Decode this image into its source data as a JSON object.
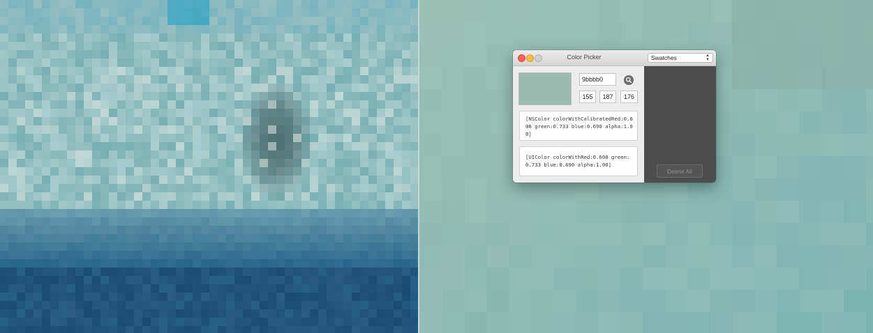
{
  "window": {
    "title": "Color Picker",
    "mode_select": {
      "selected": "Swatches"
    }
  },
  "color": {
    "hex": "9bbbb0",
    "rgb": {
      "r": "155",
      "g": "187",
      "b": "176"
    },
    "swatch_color": "#9bbbb0"
  },
  "code": {
    "nscolor": "[NSColor colorWithCalibratedRed:0.608 green:0.733 blue:0.690 alpha:1.00]",
    "uicolor": "[UIColor colorWithRed:0.608 green:0.733 blue:0.690 alpha:1.00]"
  },
  "swatches_panel": {
    "delete_all_label": "Delete All"
  },
  "icons": {
    "magnifier": "magnifier-icon",
    "select_arrows": "chevron-updown-icon"
  }
}
